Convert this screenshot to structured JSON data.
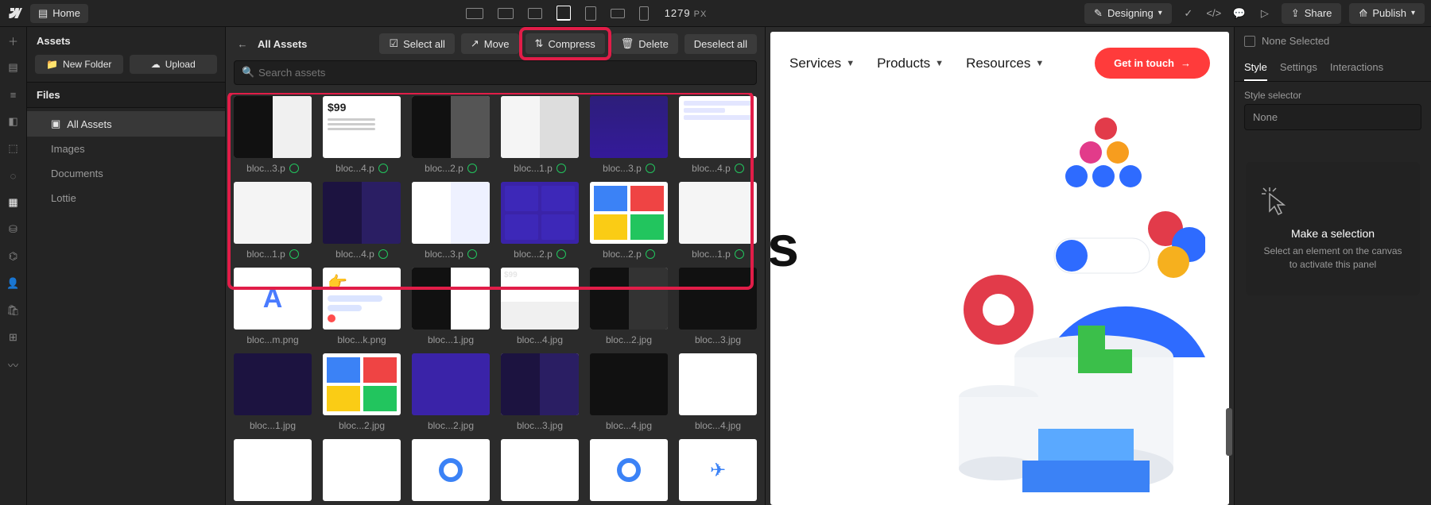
{
  "topbar": {
    "home": "Home",
    "viewport_value": "1279",
    "viewport_unit": "PX",
    "mode": "Designing",
    "share": "Share",
    "publish": "Publish"
  },
  "assets_panel": {
    "title": "Assets",
    "new_folder": "New Folder",
    "upload": "Upload",
    "files_heading": "Files",
    "tree": {
      "all": "All Assets",
      "images": "Images",
      "documents": "Documents",
      "lottie": "Lottie"
    }
  },
  "center": {
    "breadcrumb": "All Assets",
    "buttons": {
      "select_all": "Select all",
      "move": "Move",
      "compress": "Compress",
      "delete": "Delete",
      "deselect_all": "Deselect all"
    },
    "search_placeholder": "Search assets",
    "cells": [
      {
        "label": "bloc...3.p",
        "checked": true
      },
      {
        "label": "bloc...4.p",
        "checked": true
      },
      {
        "label": "bloc...2.p",
        "checked": true
      },
      {
        "label": "bloc...1.p",
        "checked": true
      },
      {
        "label": "bloc...3.p",
        "checked": true
      },
      {
        "label": "bloc...4.p",
        "checked": true
      },
      {
        "label": "bloc...1.p",
        "checked": true
      },
      {
        "label": "bloc...4.p",
        "checked": true
      },
      {
        "label": "bloc...3.p",
        "checked": true
      },
      {
        "label": "bloc...2.p",
        "checked": true
      },
      {
        "label": "bloc...2.p",
        "checked": true
      },
      {
        "label": "bloc...1.p",
        "checked": true
      },
      {
        "label": "bloc...m.png",
        "checked": false
      },
      {
        "label": "bloc...k.png",
        "checked": false
      },
      {
        "label": "bloc...1.jpg",
        "checked": false
      },
      {
        "label": "bloc...4.jpg",
        "checked": false
      },
      {
        "label": "bloc...2.jpg",
        "checked": false
      },
      {
        "label": "bloc...3.jpg",
        "checked": false
      },
      {
        "label": "bloc...1.jpg",
        "checked": false
      },
      {
        "label": "bloc...2.jpg",
        "checked": false
      },
      {
        "label": "bloc...2.jpg",
        "checked": false
      },
      {
        "label": "bloc...3.jpg",
        "checked": false
      },
      {
        "label": "bloc...4.jpg",
        "checked": false
      },
      {
        "label": "bloc...4.jpg",
        "checked": false
      }
    ]
  },
  "canvas": {
    "nav": {
      "services": "Services",
      "products": "Products",
      "resources": "Resources"
    },
    "cta": "Get in touch",
    "hero_fragment": "s"
  },
  "right_panel": {
    "none_selected": "None Selected",
    "tabs": {
      "style": "Style",
      "settings": "Settings",
      "interactions": "Interactions"
    },
    "selector_label": "Style selector",
    "selector_value": "None",
    "empty_title": "Make a selection",
    "empty_sub": "Select an element on the canvas to activate this panel"
  }
}
